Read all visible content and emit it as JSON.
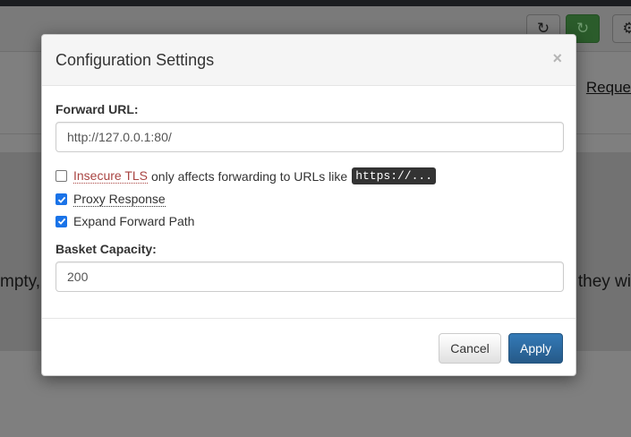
{
  "background": {
    "requests_link": "Reque",
    "left_text": "mpty,",
    "right_text": "they wi",
    "colors": {
      "green_button": "#2b5c2b"
    }
  },
  "modal": {
    "title": "Configuration Settings",
    "close_glyph": "×",
    "forward_url": {
      "label": "Forward URL:",
      "value": "http://127.0.0.1:80/"
    },
    "insecure_tls": {
      "checked": false,
      "label": "Insecure TLS",
      "help_text": "only affects forwarding to URLs like",
      "code": "https://..."
    },
    "proxy_response": {
      "checked": true,
      "label": "Proxy Response"
    },
    "expand_forward_path": {
      "checked": true,
      "label": "Expand Forward Path"
    },
    "basket_capacity": {
      "label": "Basket Capacity:",
      "value": "200"
    },
    "buttons": {
      "cancel": "Cancel",
      "apply": "Apply"
    },
    "colors": {
      "checkbox_on": "#1a73e8",
      "danger": "#a94442",
      "primary": "#337ab7"
    }
  }
}
